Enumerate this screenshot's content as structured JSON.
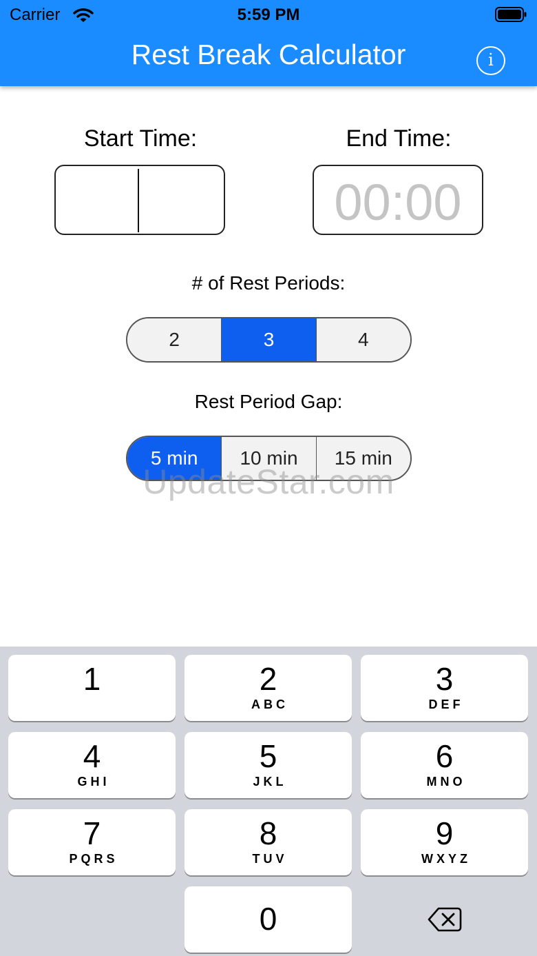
{
  "status_bar": {
    "carrier": "Carrier",
    "time": "5:59 PM"
  },
  "nav": {
    "title": "Rest Break Calculator",
    "info_glyph": "i",
    "header_color": "#1a8cff"
  },
  "times": {
    "start_label": "Start Time:",
    "start_value": "",
    "end_label": "End Time:",
    "end_placeholder": "00:00"
  },
  "rest_periods": {
    "label": "# of Rest Periods:",
    "options": [
      "2",
      "3",
      "4"
    ],
    "selected": "3"
  },
  "rest_gap": {
    "label": "Rest Period Gap:",
    "options": [
      "5 min",
      "10 min",
      "15 min"
    ],
    "selected": "5 min"
  },
  "accent_color": "#0e5ef0",
  "watermark": "UpdateStar.com",
  "keypad": {
    "keys": [
      {
        "digit": "1",
        "letters": ""
      },
      {
        "digit": "2",
        "letters": "ABC"
      },
      {
        "digit": "3",
        "letters": "DEF"
      },
      {
        "digit": "4",
        "letters": "GHI"
      },
      {
        "digit": "5",
        "letters": "JKL"
      },
      {
        "digit": "6",
        "letters": "MNO"
      },
      {
        "digit": "7",
        "letters": "PQRS"
      },
      {
        "digit": "8",
        "letters": "TUV"
      },
      {
        "digit": "9",
        "letters": "WXYZ"
      },
      {
        "digit": "0",
        "letters": ""
      }
    ],
    "delete_icon": "backspace-icon"
  }
}
